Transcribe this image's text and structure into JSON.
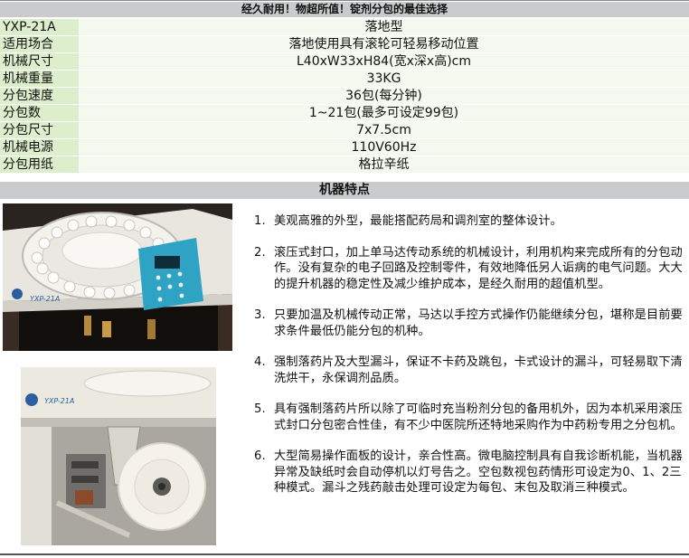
{
  "banner": "经久耐用！物超所值！锭剂分包的最佳选择",
  "specs": [
    {
      "label": "YXP-21A",
      "value": "落地型"
    },
    {
      "label": "适用场合",
      "value": "落地使用具有滚轮可轻易移动位置"
    },
    {
      "label": "机械尺寸",
      "value": "L40xW33xH84(宽x深x高)cm"
    },
    {
      "label": "机械重量",
      "value": "33KG"
    },
    {
      "label": "分包速度",
      "value": "36包(每分钟)"
    },
    {
      "label": "分包数",
      "value": "1~21包(最多可设定99包)"
    },
    {
      "label": "分包尺寸",
      "value": "7x7.5cm"
    },
    {
      "label": "机械电源",
      "value": "110V60Hz"
    },
    {
      "label": "分包用纸",
      "value": "格拉辛纸"
    }
  ],
  "features_title": "机器特点",
  "photo1": {
    "model_label": "YXP-21A"
  },
  "photo2": {
    "model_label": "YXP-21A"
  },
  "features": [
    {
      "num": "1.",
      "text": "美观高雅的外型，最能搭配药局和调剂室的整体设计。"
    },
    {
      "num": "2.",
      "text": "滚压式封口，加上单马达传动系统的机械设计，利用机构来完成所有的分包动作。没有复杂的电子回路及控制零件，有效地降低另人诟病的电气问题。大大的提升机器的稳定性及减少维护成本，是经久耐用的超值机型。"
    },
    {
      "num": "3.",
      "text": "只要加温及机械传动正常，马达以手控方式操作仍能继续分包，堪称是目前要求条件最低仍能分包的机种。"
    },
    {
      "num": "4.",
      "text": "强制落药片及大型漏斗，保证不卡药及跳包，卡式设计的漏斗，可轻易取下清洗烘干，永保调剂品质。"
    },
    {
      "num": "5.",
      "text": "具有强制落药片所以除了可临时充当粉剂分包的备用机外，因为本机采用滚压式封口分包密合性佳，有不少中医院所还特地采购作为中药粉专用之分包机。"
    },
    {
      "num": "6.",
      "text": "大型简易操作面板的设计，亲合性高。微电脑控制具有自我诊断机能，当机器异常及缺纸时会自动停机以灯号告之。空包数视包药情形可设定为0、1、2三种模式。漏斗之残药敲击处理可设定为每包、末包及取消三种模式。"
    }
  ]
}
